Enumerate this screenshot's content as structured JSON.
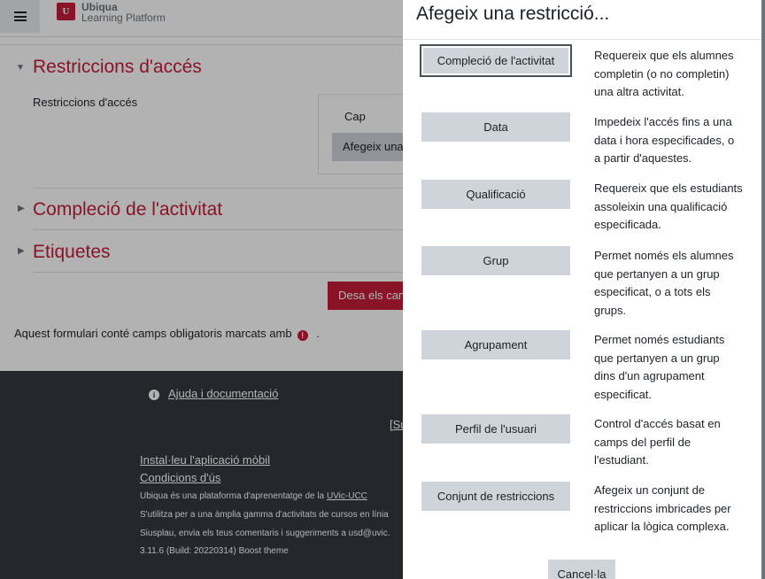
{
  "header": {
    "brand_name": "Ubiqua",
    "brand_sub": "Learning Platform",
    "logo_letter": "U"
  },
  "form": {
    "sections": [
      {
        "title": "Restriccions d'accés",
        "expanded": true
      },
      {
        "title": "Compleció de l'activitat",
        "expanded": false
      },
      {
        "title": "Etiquetes",
        "expanded": false
      }
    ],
    "field_label": "Restriccions d'accés",
    "cap_text": "Cap",
    "add_restriction_label": "Afegeix una restricció...",
    "save_label": "Desa els canvis",
    "required_note": "Aquest formulari conté camps obligatoris marcats amb",
    "required_suffix": "."
  },
  "footer": {
    "help_label": "Ajuda i documentació",
    "su_label": "[Su",
    "install_app": "Instal·leu l'aplicació mòbil",
    "terms": "Condicions d'ús",
    "line1_pre": "Ubiqua és una plataforma d'aprenentatge de la ",
    "line1_link": "UVic-UCC",
    "line2": "S'utilitza per a una àmplia gamma d'activitats de cursos en línia",
    "line3": "Siusplau, envia els teus comentaris i suggeriments a usd@uvic.",
    "line4": "3.11.6 (Build: 20220314) Boost theme"
  },
  "modal": {
    "title": "Afegeix una restricció...",
    "options": [
      {
        "label": "Compleció de l'activitat",
        "desc": "Requereix que els alumnes completin (o no completin) una altra activitat."
      },
      {
        "label": "Data",
        "desc": "Impedeix l'accés fins a una data i hora especificades, o a partir d'aquestes."
      },
      {
        "label": "Qualificació",
        "desc": "Requereix que els estudiants assoleixin una qualificació especificada."
      },
      {
        "label": "Grup",
        "desc": "Permet només els alumnes que pertanyen a un grup especificat, o a tots els grups."
      },
      {
        "label": "Agrupament",
        "desc": "Permet només estudiants que pertanyen a un grup dins d'un agrupament especificat."
      },
      {
        "label": "Perfil de l'usuari",
        "desc": "Control d'accés basat en camps del perfil de l'estudiant."
      },
      {
        "label": "Conjunt de restriccions",
        "desc": "Afegeix un conjunt de restriccions imbricades per aplicar la lògica complexa."
      }
    ],
    "cancel_label": "Cancel·la"
  },
  "colors": {
    "accent": "#c41e3a",
    "footer_bg": "#343a40",
    "button_bg": "#ced4da"
  }
}
